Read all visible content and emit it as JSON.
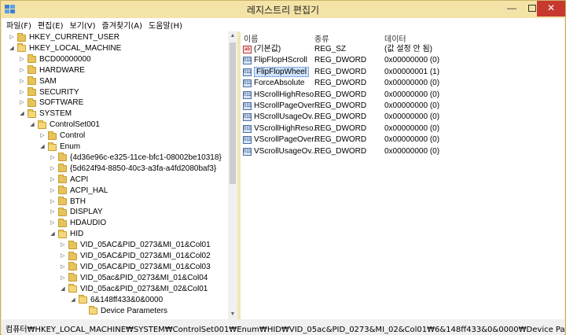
{
  "window": {
    "title": "레지스트리 편집기",
    "controls": {
      "minimize": "—",
      "maximize": "",
      "close": "✕"
    }
  },
  "menu": [
    "파일(F)",
    "편집(E)",
    "보기(V)",
    "즐겨찾기(A)",
    "도움말(H)"
  ],
  "tree": [
    {
      "label": "HKEY_CURRENT_USER",
      "depth": 1,
      "expander": "▷",
      "open": false
    },
    {
      "label": "HKEY_LOCAL_MACHINE",
      "depth": 1,
      "expander": "◢",
      "open": true
    },
    {
      "label": "BCD00000000",
      "depth": 2,
      "expander": "▷",
      "open": false
    },
    {
      "label": "HARDWARE",
      "depth": 2,
      "expander": "▷",
      "open": false
    },
    {
      "label": "SAM",
      "depth": 2,
      "expander": "▷",
      "open": false
    },
    {
      "label": "SECURITY",
      "depth": 2,
      "expander": "▷",
      "open": false
    },
    {
      "label": "SOFTWARE",
      "depth": 2,
      "expander": "▷",
      "open": false
    },
    {
      "label": "SYSTEM",
      "depth": 2,
      "expander": "◢",
      "open": true
    },
    {
      "label": "ControlSet001",
      "depth": 3,
      "expander": "◢",
      "open": true
    },
    {
      "label": "Control",
      "depth": 4,
      "expander": "▷",
      "open": false
    },
    {
      "label": "Enum",
      "depth": 4,
      "expander": "◢",
      "open": true
    },
    {
      "label": "{4d36e96c-e325-11ce-bfc1-08002be10318}",
      "depth": 5,
      "expander": "▷",
      "open": false
    },
    {
      "label": "{5d624f94-8850-40c3-a3fa-a4fd2080baf3}",
      "depth": 5,
      "expander": "▷",
      "open": false
    },
    {
      "label": "ACPI",
      "depth": 5,
      "expander": "▷",
      "open": false
    },
    {
      "label": "ACPI_HAL",
      "depth": 5,
      "expander": "▷",
      "open": false
    },
    {
      "label": "BTH",
      "depth": 5,
      "expander": "▷",
      "open": false
    },
    {
      "label": "DISPLAY",
      "depth": 5,
      "expander": "▷",
      "open": false
    },
    {
      "label": "HDAUDIO",
      "depth": 5,
      "expander": "▷",
      "open": false
    },
    {
      "label": "HID",
      "depth": 5,
      "expander": "◢",
      "open": true
    },
    {
      "label": "VID_05AC&PID_0273&MI_01&Col01",
      "depth": 6,
      "expander": "▷",
      "open": false
    },
    {
      "label": "VID_05AC&PID_0273&MI_01&Col02",
      "depth": 6,
      "expander": "▷",
      "open": false
    },
    {
      "label": "VID_05AC&PID_0273&MI_01&Col03",
      "depth": 6,
      "expander": "▷",
      "open": false
    },
    {
      "label": "VID_05ac&PID_0273&MI_01&Col04",
      "depth": 6,
      "expander": "▷",
      "open": false
    },
    {
      "label": "VID_05ac&PID_0273&MI_02&Col01",
      "depth": 6,
      "expander": "◢",
      "open": true
    },
    {
      "label": "6&148ff433&0&0000",
      "depth": 7,
      "expander": "◢",
      "open": true
    },
    {
      "label": "Device Parameters",
      "depth": 8,
      "expander": "",
      "open": true,
      "selected": true
    }
  ],
  "list": {
    "headers": {
      "name": "이름",
      "type": "종류",
      "data": "데이터"
    },
    "rows": [
      {
        "icon": "ab",
        "name": "(기본값)",
        "type": "REG_SZ",
        "data": "(값 설정 안 됨)"
      },
      {
        "icon": "bin",
        "name": "FlipFlopHScroll",
        "type": "REG_DWORD",
        "data": "0x00000000 (0)"
      },
      {
        "icon": "bin",
        "name": "FlipFlopWheel",
        "type": "REG_DWORD",
        "data": "0x00000001 (1)",
        "selected": true
      },
      {
        "icon": "bin",
        "name": "ForceAbsolute",
        "type": "REG_DWORD",
        "data": "0x00000000 (0)"
      },
      {
        "icon": "bin",
        "name": "HScrollHighReso...",
        "type": "REG_DWORD",
        "data": "0x00000000 (0)"
      },
      {
        "icon": "bin",
        "name": "HScrollPageOver...",
        "type": "REG_DWORD",
        "data": "0x00000000 (0)"
      },
      {
        "icon": "bin",
        "name": "HScrollUsageOv...",
        "type": "REG_DWORD",
        "data": "0x00000000 (0)"
      },
      {
        "icon": "bin",
        "name": "VScrollHighReso...",
        "type": "REG_DWORD",
        "data": "0x00000000 (0)"
      },
      {
        "icon": "bin",
        "name": "VScrollPageOver...",
        "type": "REG_DWORD",
        "data": "0x00000000 (0)"
      },
      {
        "icon": "bin",
        "name": "VScrollUsageOv...",
        "type": "REG_DWORD",
        "data": "0x00000000 (0)"
      }
    ]
  },
  "status": "컴퓨터₩HKEY_LOCAL_MACHINE₩SYSTEM₩ControlSet001₩Enum₩HID₩VID_05ac&PID_0273&MI_02&Col01₩6&148ff433&0&0000₩Device Parameters"
}
